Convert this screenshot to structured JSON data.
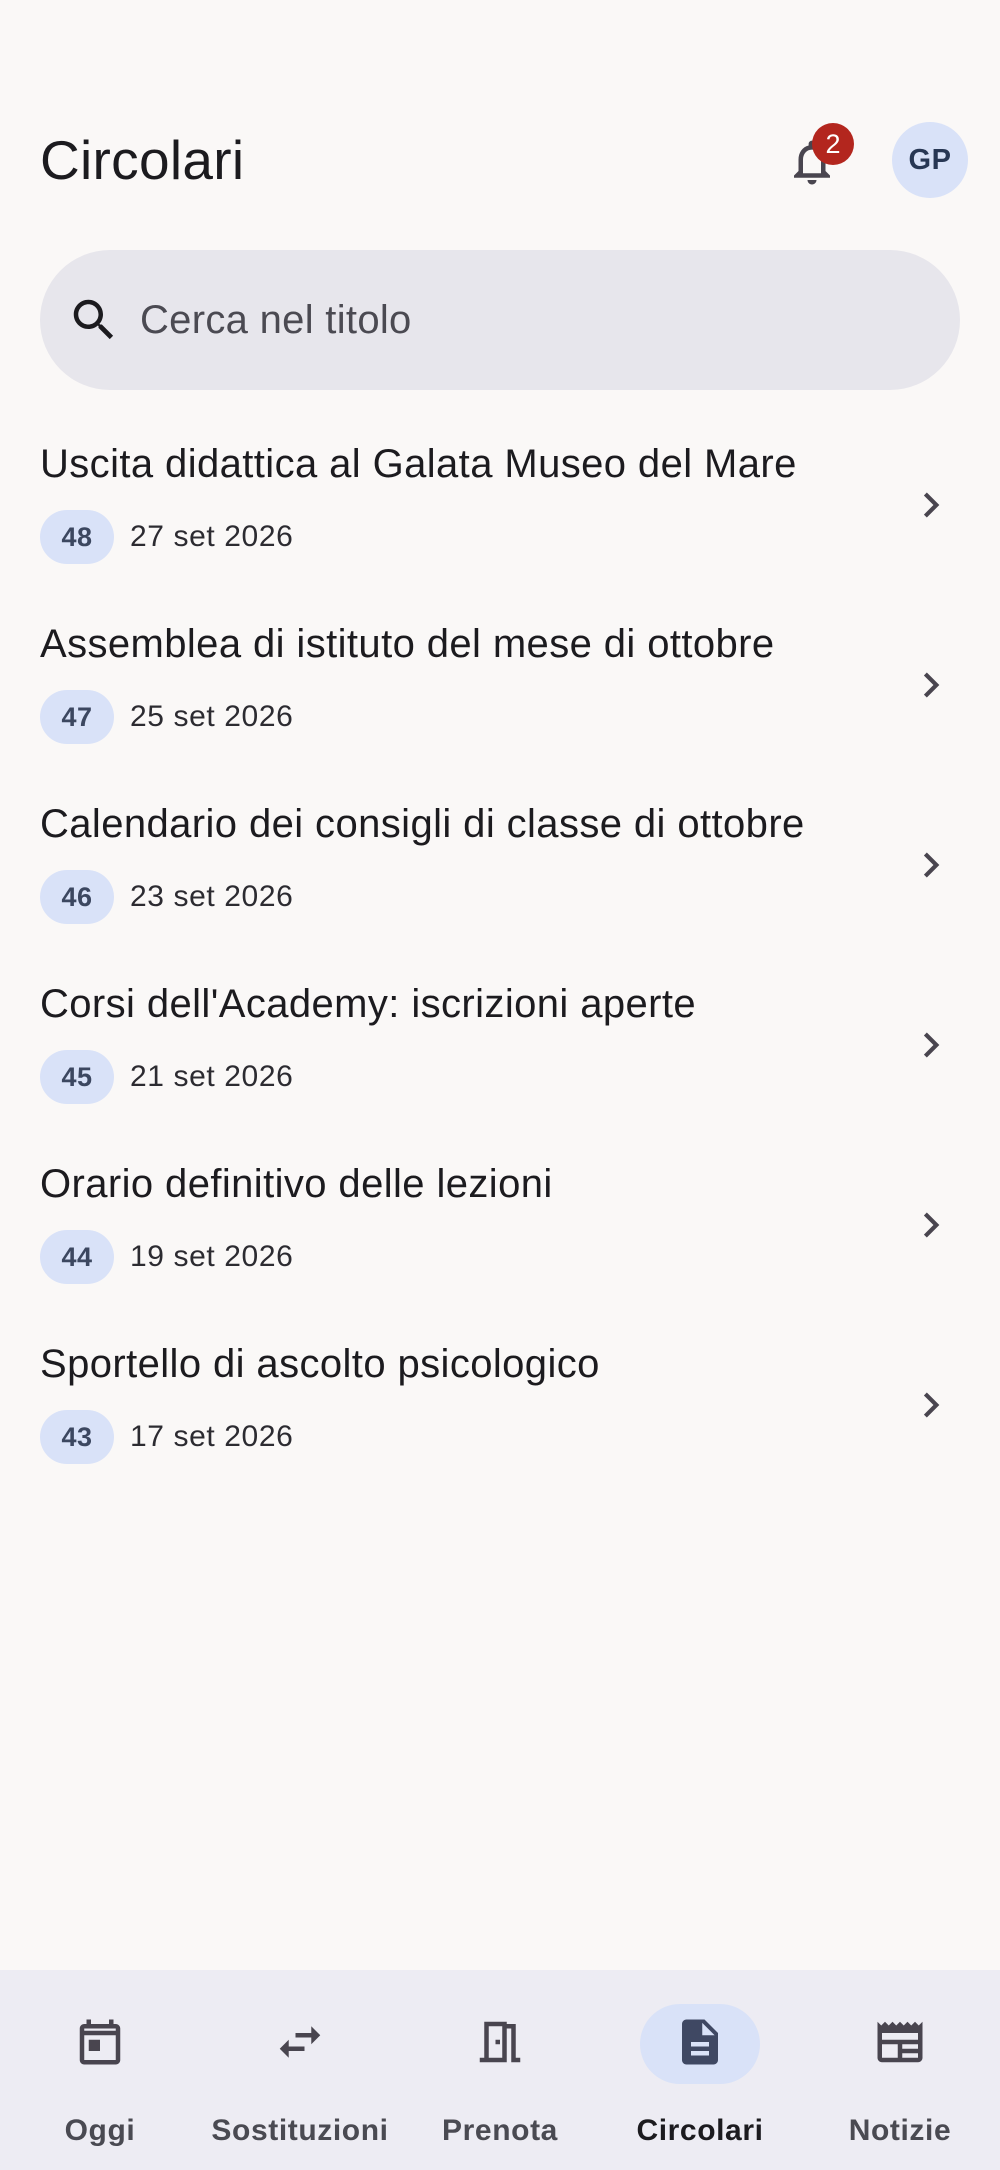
{
  "header": {
    "title": "Circolari",
    "notification_count": "2",
    "avatar_initials": "GP"
  },
  "search": {
    "placeholder": "Cerca nel titolo",
    "value": ""
  },
  "circolari": [
    {
      "title": "Uscita didattica al Galata Museo del Mare",
      "number": "48",
      "date": "27 set 2026"
    },
    {
      "title": "Assemblea di istituto del mese di ottobre",
      "number": "47",
      "date": "25 set 2026"
    },
    {
      "title": "Calendario dei consigli di classe di ottobre",
      "number": "46",
      "date": "23 set 2026"
    },
    {
      "title": "Corsi dell'Academy: iscrizioni aperte",
      "number": "45",
      "date": "21 set 2026"
    },
    {
      "title": "Orario definitivo delle lezioni",
      "number": "44",
      "date": "19 set 2026"
    },
    {
      "title": "Sportello di ascolto psicologico",
      "number": "43",
      "date": "17 set 2026"
    }
  ],
  "nav": [
    {
      "label": "Oggi",
      "icon": "calendar-icon",
      "active": false
    },
    {
      "label": "Sostituzioni",
      "icon": "swap-arrows-icon",
      "active": false
    },
    {
      "label": "Prenota",
      "icon": "door-icon",
      "active": false
    },
    {
      "label": "Circolari",
      "icon": "document-icon",
      "active": true
    },
    {
      "label": "Notizie",
      "icon": "newspaper-icon",
      "active": false
    }
  ],
  "colors": {
    "accent_container": "#d9e2f8",
    "badge_red": "#b3261e",
    "background": "#faf8f7",
    "nav_background": "#edecf3"
  }
}
